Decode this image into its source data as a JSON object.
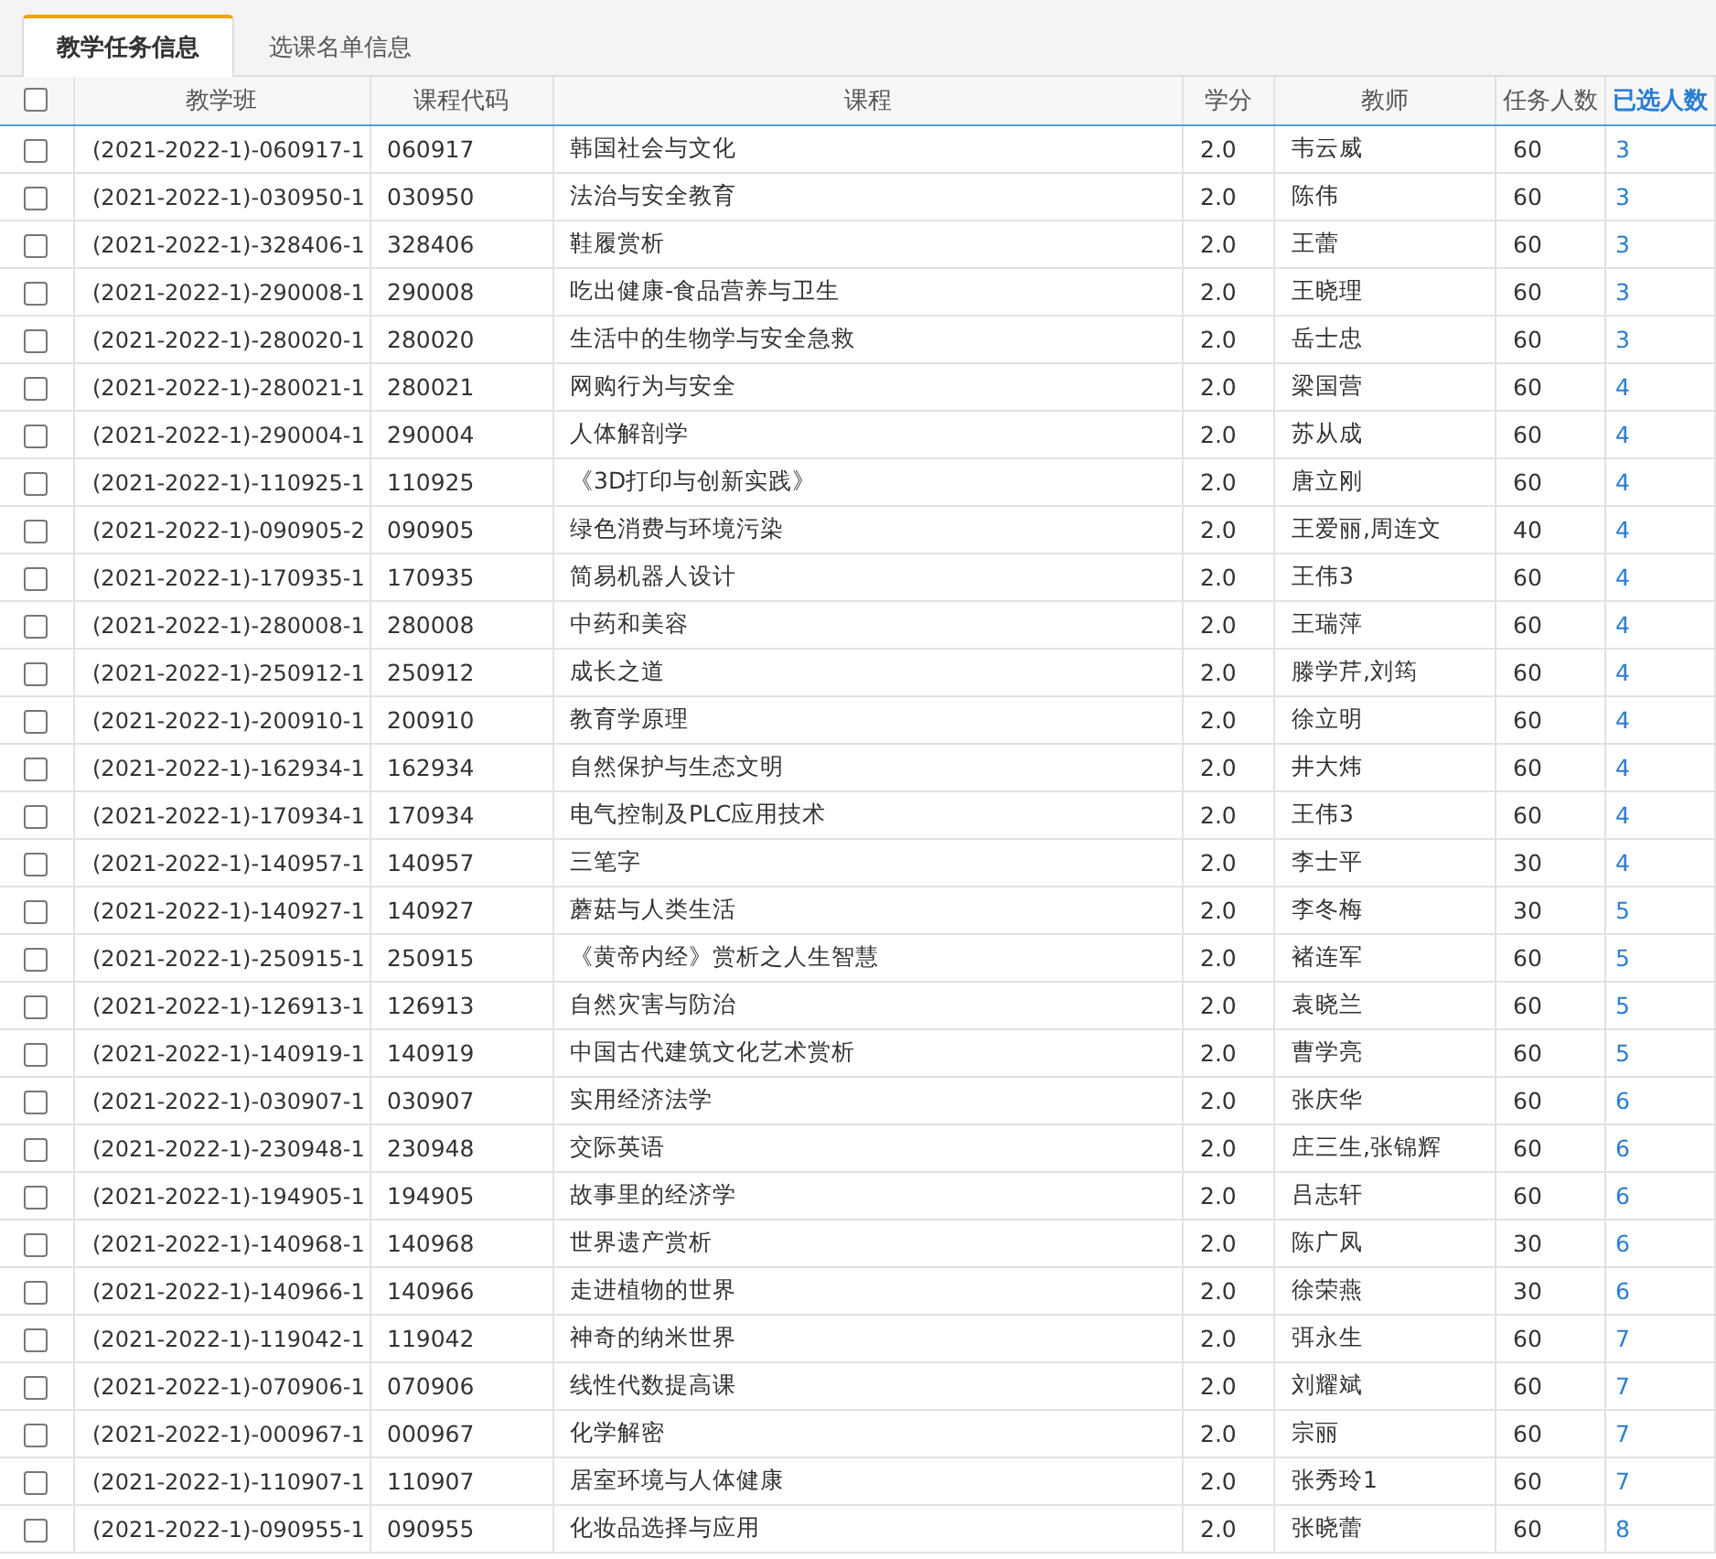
{
  "tabs": [
    {
      "label": "教学任务信息",
      "selected": true
    },
    {
      "label": "选课名单信息",
      "selected": false
    }
  ],
  "table": {
    "select_all": {
      "checked": false
    },
    "columns": [
      {
        "label": "教学班",
        "sorted": false
      },
      {
        "label": "课程代码",
        "sorted": false
      },
      {
        "label": "课程",
        "sorted": false
      },
      {
        "label": "学分",
        "sorted": false
      },
      {
        "label": "教师",
        "sorted": false
      },
      {
        "label": "任务人数",
        "sorted": false
      },
      {
        "label": "已选人数",
        "sorted": true
      }
    ],
    "rows": [
      {
        "checked": false,
        "class": "(2021-2022-1)-060917-1",
        "code": "060917",
        "course": "韩国社会与文化",
        "credit": "2.0",
        "teacher": "韦云威",
        "capacity": "60",
        "enrolled": "3"
      },
      {
        "checked": false,
        "class": "(2021-2022-1)-030950-1",
        "code": "030950",
        "course": "法治与安全教育",
        "credit": "2.0",
        "teacher": "陈伟",
        "capacity": "60",
        "enrolled": "3"
      },
      {
        "checked": false,
        "class": "(2021-2022-1)-328406-1",
        "code": "328406",
        "course": "鞋履赏析",
        "credit": "2.0",
        "teacher": "王蕾",
        "capacity": "60",
        "enrolled": "3"
      },
      {
        "checked": false,
        "class": "(2021-2022-1)-290008-1",
        "code": "290008",
        "course": "吃出健康-食品营养与卫生",
        "credit": "2.0",
        "teacher": "王晓理",
        "capacity": "60",
        "enrolled": "3"
      },
      {
        "checked": false,
        "class": "(2021-2022-1)-280020-1",
        "code": "280020",
        "course": "生活中的生物学与安全急救",
        "credit": "2.0",
        "teacher": "岳士忠",
        "capacity": "60",
        "enrolled": "3"
      },
      {
        "checked": false,
        "class": "(2021-2022-1)-280021-1",
        "code": "280021",
        "course": "网购行为与安全",
        "credit": "2.0",
        "teacher": "梁国营",
        "capacity": "60",
        "enrolled": "4"
      },
      {
        "checked": false,
        "class": "(2021-2022-1)-290004-1",
        "code": "290004",
        "course": "人体解剖学",
        "credit": "2.0",
        "teacher": "苏从成",
        "capacity": "60",
        "enrolled": "4"
      },
      {
        "checked": false,
        "class": "(2021-2022-1)-110925-1",
        "code": "110925",
        "course": "《3D打印与创新实践》",
        "credit": "2.0",
        "teacher": "唐立刚",
        "capacity": "60",
        "enrolled": "4"
      },
      {
        "checked": false,
        "class": "(2021-2022-1)-090905-2",
        "code": "090905",
        "course": "绿色消费与环境污染",
        "credit": "2.0",
        "teacher": "王爱丽,周连文",
        "capacity": "40",
        "enrolled": "4"
      },
      {
        "checked": false,
        "class": "(2021-2022-1)-170935-1",
        "code": "170935",
        "course": "简易机器人设计",
        "credit": "2.0",
        "teacher": "王伟3",
        "capacity": "60",
        "enrolled": "4"
      },
      {
        "checked": false,
        "class": "(2021-2022-1)-280008-1",
        "code": "280008",
        "course": "中药和美容",
        "credit": "2.0",
        "teacher": "王瑞萍",
        "capacity": "60",
        "enrolled": "4"
      },
      {
        "checked": false,
        "class": "(2021-2022-1)-250912-1",
        "code": "250912",
        "course": "成长之道",
        "credit": "2.0",
        "teacher": "滕学芹,刘筠",
        "capacity": "60",
        "enrolled": "4"
      },
      {
        "checked": false,
        "class": "(2021-2022-1)-200910-1",
        "code": "200910",
        "course": "教育学原理",
        "credit": "2.0",
        "teacher": "徐立明",
        "capacity": "60",
        "enrolled": "4"
      },
      {
        "checked": false,
        "class": "(2021-2022-1)-162934-1",
        "code": "162934",
        "course": "自然保护与生态文明",
        "credit": "2.0",
        "teacher": "井大炜",
        "capacity": "60",
        "enrolled": "4"
      },
      {
        "checked": false,
        "class": "(2021-2022-1)-170934-1",
        "code": "170934",
        "course": "电气控制及PLC应用技术",
        "credit": "2.0",
        "teacher": "王伟3",
        "capacity": "60",
        "enrolled": "4"
      },
      {
        "checked": false,
        "class": "(2021-2022-1)-140957-1",
        "code": "140957",
        "course": "三笔字",
        "credit": "2.0",
        "teacher": "李士平",
        "capacity": "30",
        "enrolled": "4"
      },
      {
        "checked": false,
        "class": "(2021-2022-1)-140927-1",
        "code": "140927",
        "course": "蘑菇与人类生活",
        "credit": "2.0",
        "teacher": "李冬梅",
        "capacity": "30",
        "enrolled": "5"
      },
      {
        "checked": false,
        "class": "(2021-2022-1)-250915-1",
        "code": "250915",
        "course": "《黄帝内经》赏析之人生智慧",
        "credit": "2.0",
        "teacher": "褚连军",
        "capacity": "60",
        "enrolled": "5"
      },
      {
        "checked": false,
        "class": "(2021-2022-1)-126913-1",
        "code": "126913",
        "course": "自然灾害与防治",
        "credit": "2.0",
        "teacher": "袁晓兰",
        "capacity": "60",
        "enrolled": "5"
      },
      {
        "checked": false,
        "class": "(2021-2022-1)-140919-1",
        "code": "140919",
        "course": "中国古代建筑文化艺术赏析",
        "credit": "2.0",
        "teacher": "曹学亮",
        "capacity": "60",
        "enrolled": "5"
      },
      {
        "checked": false,
        "class": "(2021-2022-1)-030907-1",
        "code": "030907",
        "course": "实用经济法学",
        "credit": "2.0",
        "teacher": "张庆华",
        "capacity": "60",
        "enrolled": "6"
      },
      {
        "checked": false,
        "class": "(2021-2022-1)-230948-1",
        "code": "230948",
        "course": "交际英语",
        "credit": "2.0",
        "teacher": "庄三生,张锦辉",
        "capacity": "60",
        "enrolled": "6"
      },
      {
        "checked": false,
        "class": "(2021-2022-1)-194905-1",
        "code": "194905",
        "course": "故事里的经济学",
        "credit": "2.0",
        "teacher": "吕志轩",
        "capacity": "60",
        "enrolled": "6"
      },
      {
        "checked": false,
        "class": "(2021-2022-1)-140968-1",
        "code": "140968",
        "course": "世界遗产赏析",
        "credit": "2.0",
        "teacher": "陈广凤",
        "capacity": "30",
        "enrolled": "6"
      },
      {
        "checked": false,
        "class": "(2021-2022-1)-140966-1",
        "code": "140966",
        "course": "走进植物的世界",
        "credit": "2.0",
        "teacher": "徐荣燕",
        "capacity": "30",
        "enrolled": "6"
      },
      {
        "checked": false,
        "class": "(2021-2022-1)-119042-1",
        "code": "119042",
        "course": "神奇的纳米世界",
        "credit": "2.0",
        "teacher": "弭永生",
        "capacity": "60",
        "enrolled": "7"
      },
      {
        "checked": false,
        "class": "(2021-2022-1)-070906-1",
        "code": "070906",
        "course": "线性代数提高课",
        "credit": "2.0",
        "teacher": "刘耀斌",
        "capacity": "60",
        "enrolled": "7"
      },
      {
        "checked": false,
        "class": "(2021-2022-1)-000967-1",
        "code": "000967",
        "course": "化学解密",
        "credit": "2.0",
        "teacher": "宗丽",
        "capacity": "60",
        "enrolled": "7"
      },
      {
        "checked": false,
        "class": "(2021-2022-1)-110907-1",
        "code": "110907",
        "course": "居室环境与人体健康",
        "credit": "2.0",
        "teacher": "张秀玲1",
        "capacity": "60",
        "enrolled": "7"
      },
      {
        "checked": false,
        "class": "(2021-2022-1)-090955-1",
        "code": "090955",
        "course": "化妆品选择与应用",
        "credit": "2.0",
        "teacher": "张晓蕾",
        "capacity": "60",
        "enrolled": "8"
      }
    ]
  }
}
